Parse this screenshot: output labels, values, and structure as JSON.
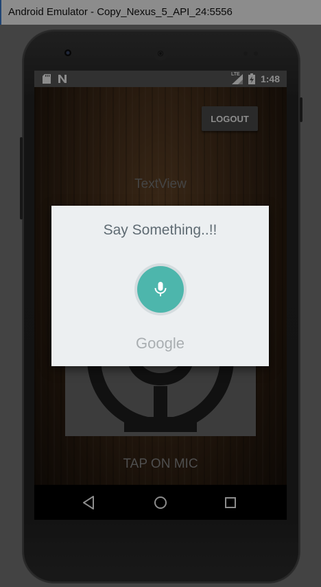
{
  "window": {
    "title": "Android Emulator - Copy_Nexus_5_API_24:5556"
  },
  "status_bar": {
    "time": "1:48",
    "network_label": "LTE"
  },
  "app": {
    "logout_label": "LOGOUT",
    "textview": "TextView",
    "tap_label": "TAP ON MIC"
  },
  "dialog": {
    "prompt": "Say Something..!!",
    "brand": "Google",
    "mic_color": "#4db6ac"
  },
  "navigation": {
    "back": "back-icon",
    "home": "home-icon",
    "recents": "recents-icon"
  }
}
